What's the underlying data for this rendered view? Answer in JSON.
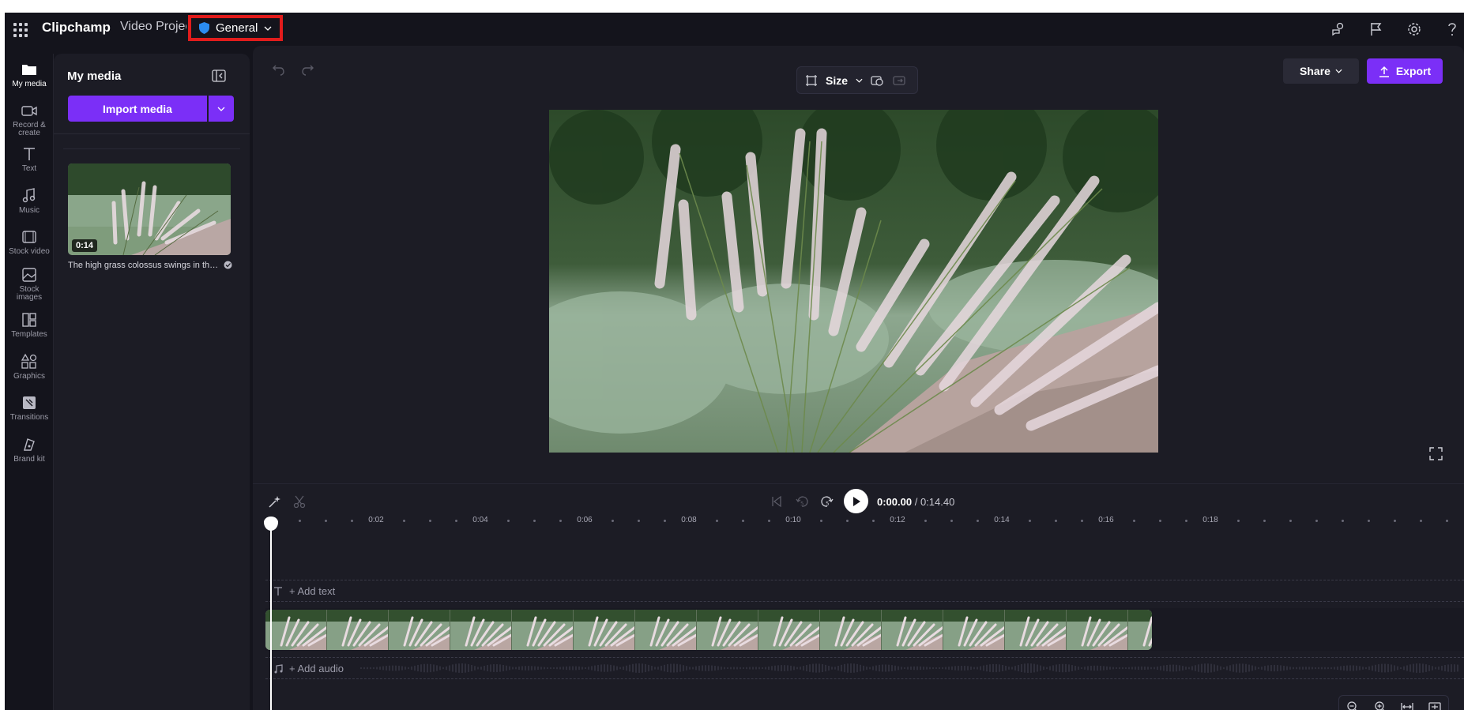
{
  "topbar": {
    "brand": "Clipchamp",
    "project_name": "Video Project",
    "workspace_label": "General"
  },
  "leftnav": {
    "items": [
      {
        "label": "My media",
        "icon": "folder-icon"
      },
      {
        "label": "Record &\ncreate",
        "icon": "camera-icon"
      },
      {
        "label": "Text",
        "icon": "text-icon"
      },
      {
        "label": "Music",
        "icon": "music-note-icon"
      },
      {
        "label": "Stock video",
        "icon": "film-icon"
      },
      {
        "label": "Stock\nimages",
        "icon": "image-icon"
      },
      {
        "label": "Templates",
        "icon": "templates-icon"
      },
      {
        "label": "Graphics",
        "icon": "shapes-icon"
      },
      {
        "label": "Transitions",
        "icon": "transition-icon"
      },
      {
        "label": "Brand kit",
        "icon": "brand-kit-icon"
      }
    ]
  },
  "media_panel": {
    "title": "My media",
    "import_label": "Import media",
    "media_item": {
      "duration": "0:14",
      "caption": "The high grass colossus swings in the wind"
    }
  },
  "editor": {
    "size_label": "Size",
    "share_label": "Share",
    "export_label": "Export",
    "current_time": "0:00.00",
    "total_time": "/ 0:14.40"
  },
  "timeline": {
    "ruler_labels": [
      "0:02",
      "0:04",
      "0:06",
      "0:08",
      "0:10",
      "0:12",
      "0:14",
      "0:16",
      "0:18"
    ],
    "add_text_label": "+ Add text",
    "add_audio_label": "+ Add audio"
  },
  "colors": {
    "accent": "#7b2ff7",
    "background": "#14141c",
    "panel": "#1c1c25",
    "highlight_box": "#e21c1c"
  }
}
